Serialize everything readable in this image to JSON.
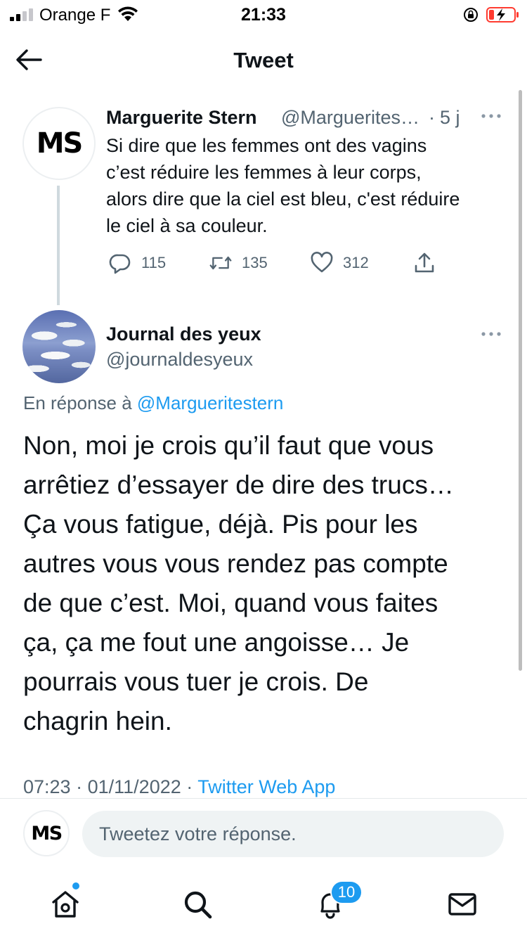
{
  "status_bar": {
    "carrier": "Orange F",
    "time": "21:33"
  },
  "header": {
    "title": "Tweet"
  },
  "parent_tweet": {
    "avatar_text": "MS",
    "name": "Marguerite Stern",
    "handle": "@Marguerites…",
    "separator": "·",
    "time": "5 j",
    "text_lines": [
      "Si dire que les femmes ont des vagins",
      "c’est réduire les femmes à leur corps,",
      "alors dire que la ciel est bleu, c'est réduire",
      "le ciel à sa couleur."
    ],
    "replies": "115",
    "retweets": "135",
    "likes": "312"
  },
  "main_tweet": {
    "name": "Journal des yeux",
    "handle": "@journaldesyeux",
    "reply_prefix": "En réponse à",
    "reply_target": "@Margueritestern",
    "text_lines": [
      "Non, moi je crois qu’il faut que vous",
      "arrêtiez d’essayer de dire des trucs…",
      "Ça vous fatigue, déjà. Pis pour les",
      "autres vous vous rendez pas compte",
      "de que c’est. Moi, quand vous faites",
      "ça, ça me fout une angoisse… Je",
      "pourrais vous tuer je crois. De",
      "chagrin hein."
    ],
    "time": "07:23",
    "date": "01/11/2022",
    "meta_sep": "·",
    "source": "Twitter Web App"
  },
  "composer": {
    "avatar_text": "MS",
    "placeholder": "Tweetez votre réponse."
  },
  "tab_bar": {
    "notifications_badge": "10"
  },
  "colors": {
    "accent": "#1d9bf0",
    "secondary_text": "#536471",
    "primary_text": "#0f1419"
  }
}
